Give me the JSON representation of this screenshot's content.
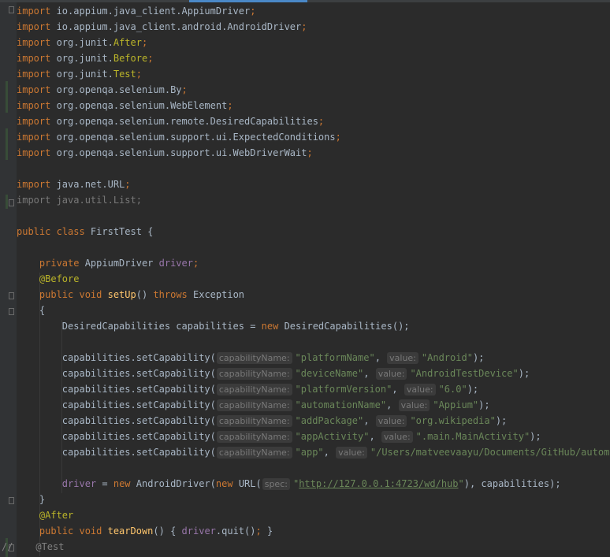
{
  "imports": [
    {
      "kw": "import",
      "pkg": " io.appium.java_client.AppiumDriver",
      "cls": "",
      "end": ";"
    },
    {
      "kw": "import",
      "pkg": " io.appium.java_client.android.AndroidDriver",
      "cls": "",
      "end": ";"
    },
    {
      "kw": "import",
      "pkg": " org.junit.",
      "cls": "After",
      "end": ";"
    },
    {
      "kw": "import",
      "pkg": " org.junit.",
      "cls": "Before",
      "end": ";"
    },
    {
      "kw": "import",
      "pkg": " org.junit.",
      "cls": "Test",
      "end": ";"
    },
    {
      "kw": "import",
      "pkg": " org.openqa.selenium.By",
      "cls": "",
      "end": ";"
    },
    {
      "kw": "import",
      "pkg": " org.openqa.selenium.WebElement",
      "cls": "",
      "end": ";"
    },
    {
      "kw": "import",
      "pkg": " org.openqa.selenium.remote.DesiredCapabilities",
      "cls": "",
      "end": ";"
    },
    {
      "kw": "import",
      "pkg": " org.openqa.selenium.support.ui.ExpectedConditions",
      "cls": "",
      "end": ";"
    },
    {
      "kw": "import",
      "pkg": " org.openqa.selenium.support.ui.WebDriverWait",
      "cls": "",
      "end": ";"
    }
  ],
  "import_url": {
    "kw": "import",
    "pkg": " java.net.URL",
    "end": ";"
  },
  "import_list": "import java.util.List;",
  "class_decl": {
    "kw": "public class ",
    "name": "FirstTest {"
  },
  "field": {
    "kw": "private ",
    "type": "AppiumDriver ",
    "name": "driver",
    "end": ";"
  },
  "before": "@Before",
  "setup_sig": {
    "kw": "public void ",
    "name": "setUp",
    "mid": "() ",
    "kw2": "throws",
    "rest": " Exception"
  },
  "open_brace": "{",
  "caps_decl": {
    "pre": "DesiredCapabilities capabilities = ",
    "kw": "new",
    "post": " DesiredCapabilities();"
  },
  "caps_call": "capabilities.setCapability(",
  "hint_name": "capabilityName:",
  "hint_value": "value:",
  "capabilities": [
    {
      "name": "\"platformName\"",
      "value": "\"Android\"",
      "end": ");"
    },
    {
      "name": "\"deviceName\"",
      "value": "\"AndroidTestDevice\"",
      "end": ");"
    },
    {
      "name": "\"platformVersion\"",
      "value": "\"6.0\"",
      "end": ");"
    },
    {
      "name": "\"automationName\"",
      "value": "\"Appium\"",
      "end": ");"
    },
    {
      "name": "\"addPackage\"",
      "value": "\"org.wikipedia\"",
      "end": ");"
    },
    {
      "name": "\"appActivity\"",
      "value": "\".main.MainActivity\"",
      "end": ");"
    },
    {
      "name": "\"app\"",
      "value": "\"/Users/matveevaayu/Documents/GitHub/automatio",
      "end": ""
    }
  ],
  "driver_line": {
    "field": "driver",
    "eq": " = ",
    "kw": "new",
    "mid": " AndroidDriver(",
    "kw2": "new",
    "mid2": " URL(",
    "hint": "spec:",
    "q1": "\"",
    "url": "http://127.0.0.1:4723/wd/hub",
    "q2": "\"",
    "rest": "), capabilities);"
  },
  "close_brace": "}",
  "after": "@After",
  "teardown": {
    "kw": "public void ",
    "name": "tearDown",
    "mid": "() ",
    "ob": "{ ",
    "fld": "driver",
    "call": ".quit()",
    "semi": ";",
    "cb": " }"
  },
  "comment_test": {
    "slashes": "//",
    "ann": "    @Test"
  },
  "comma": ", "
}
